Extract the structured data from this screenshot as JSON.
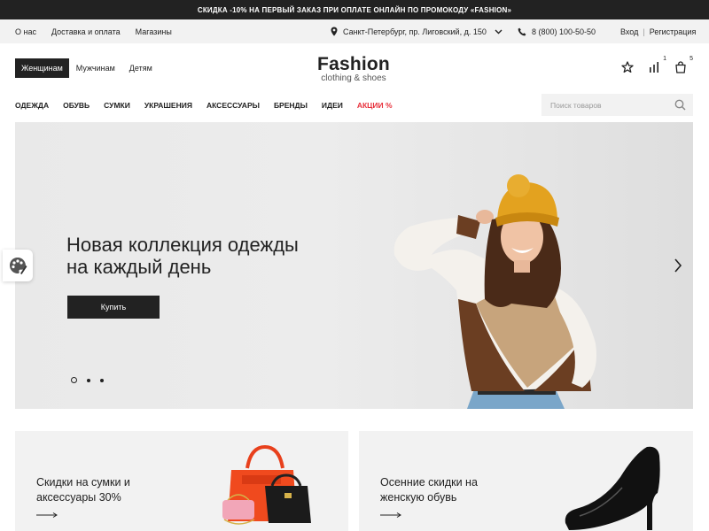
{
  "promo_bar": {
    "text": "СКИДКА -10% НА ПЕРВЫЙ ЗАКАЗ ПРИ ОПЛАТЕ ОНЛАЙН ПО ПРОМОКОДУ «FASHION»"
  },
  "util_bar": {
    "links": [
      "О нас",
      "Доставка и оплата",
      "Магазины"
    ],
    "address": "Санкт-Петербург, пр. Лиговский, д. 150",
    "phone": "8 (800) 100-50-50",
    "login": "Вход",
    "separator": "|",
    "register": "Регистрация"
  },
  "gender_tabs": [
    "Женщинам",
    "Мужчинам",
    "Детям"
  ],
  "logo": {
    "name": "Fashion",
    "tagline": "clothing & shoes"
  },
  "header_icons": {
    "favorites_icon": "star-icon",
    "compare_icon": "compare-icon",
    "compare_count": "1",
    "cart_icon": "cart-icon",
    "cart_count": "5"
  },
  "main_nav": [
    "ОДЕЖДА",
    "ОБУВЬ",
    "СУМКИ",
    "УКРАШЕНИЯ",
    "АКСЕССУАРЫ",
    "БРЕНДЫ",
    "ИДЕИ",
    "АКЦИИ %"
  ],
  "search": {
    "placeholder": "Поиск товаров",
    "value": ""
  },
  "hero": {
    "title_line1": "Новая коллекция одежды",
    "title_line2": "на каждый день",
    "button": "Купить",
    "slides_total": 3,
    "active_slide": 1
  },
  "promo_cards": [
    {
      "title_line1": "Скидки на сумки и",
      "title_line2": "аксессуары 30%"
    },
    {
      "title_line1": "Осенние скидки на",
      "title_line2": "женскую обувь"
    }
  ],
  "colors": {
    "dark": "#222222",
    "sale": "#e8303b",
    "hat": "#e3a21f",
    "light_bg": "#f2f2f2"
  }
}
